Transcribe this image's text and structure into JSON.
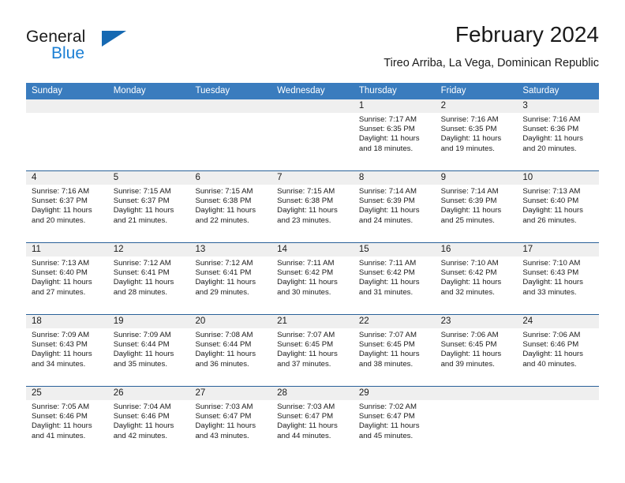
{
  "brand": {
    "name_part1": "General",
    "name_part2": "Blue",
    "logo_icon": "triangle-logo-icon",
    "accent_color": "#1b7fd4"
  },
  "header": {
    "title": "February 2024",
    "subtitle": "Tireo Arriba, La Vega, Dominican Republic"
  },
  "theme": {
    "header_blue": "#3a7cbe",
    "separator_blue": "#2a6199",
    "date_band_gray": "#efefef"
  },
  "calendar": {
    "weekdays": [
      "Sunday",
      "Monday",
      "Tuesday",
      "Wednesday",
      "Thursday",
      "Friday",
      "Saturday"
    ],
    "weeks": [
      [
        {
          "day": "",
          "sunrise": "",
          "sunset": "",
          "daylight1": "",
          "daylight2": ""
        },
        {
          "day": "",
          "sunrise": "",
          "sunset": "",
          "daylight1": "",
          "daylight2": ""
        },
        {
          "day": "",
          "sunrise": "",
          "sunset": "",
          "daylight1": "",
          "daylight2": ""
        },
        {
          "day": "",
          "sunrise": "",
          "sunset": "",
          "daylight1": "",
          "daylight2": ""
        },
        {
          "day": "1",
          "sunrise": "Sunrise: 7:17 AM",
          "sunset": "Sunset: 6:35 PM",
          "daylight1": "Daylight: 11 hours",
          "daylight2": "and 18 minutes."
        },
        {
          "day": "2",
          "sunrise": "Sunrise: 7:16 AM",
          "sunset": "Sunset: 6:35 PM",
          "daylight1": "Daylight: 11 hours",
          "daylight2": "and 19 minutes."
        },
        {
          "day": "3",
          "sunrise": "Sunrise: 7:16 AM",
          "sunset": "Sunset: 6:36 PM",
          "daylight1": "Daylight: 11 hours",
          "daylight2": "and 20 minutes."
        }
      ],
      [
        {
          "day": "4",
          "sunrise": "Sunrise: 7:16 AM",
          "sunset": "Sunset: 6:37 PM",
          "daylight1": "Daylight: 11 hours",
          "daylight2": "and 20 minutes."
        },
        {
          "day": "5",
          "sunrise": "Sunrise: 7:15 AM",
          "sunset": "Sunset: 6:37 PM",
          "daylight1": "Daylight: 11 hours",
          "daylight2": "and 21 minutes."
        },
        {
          "day": "6",
          "sunrise": "Sunrise: 7:15 AM",
          "sunset": "Sunset: 6:38 PM",
          "daylight1": "Daylight: 11 hours",
          "daylight2": "and 22 minutes."
        },
        {
          "day": "7",
          "sunrise": "Sunrise: 7:15 AM",
          "sunset": "Sunset: 6:38 PM",
          "daylight1": "Daylight: 11 hours",
          "daylight2": "and 23 minutes."
        },
        {
          "day": "8",
          "sunrise": "Sunrise: 7:14 AM",
          "sunset": "Sunset: 6:39 PM",
          "daylight1": "Daylight: 11 hours",
          "daylight2": "and 24 minutes."
        },
        {
          "day": "9",
          "sunrise": "Sunrise: 7:14 AM",
          "sunset": "Sunset: 6:39 PM",
          "daylight1": "Daylight: 11 hours",
          "daylight2": "and 25 minutes."
        },
        {
          "day": "10",
          "sunrise": "Sunrise: 7:13 AM",
          "sunset": "Sunset: 6:40 PM",
          "daylight1": "Daylight: 11 hours",
          "daylight2": "and 26 minutes."
        }
      ],
      [
        {
          "day": "11",
          "sunrise": "Sunrise: 7:13 AM",
          "sunset": "Sunset: 6:40 PM",
          "daylight1": "Daylight: 11 hours",
          "daylight2": "and 27 minutes."
        },
        {
          "day": "12",
          "sunrise": "Sunrise: 7:12 AM",
          "sunset": "Sunset: 6:41 PM",
          "daylight1": "Daylight: 11 hours",
          "daylight2": "and 28 minutes."
        },
        {
          "day": "13",
          "sunrise": "Sunrise: 7:12 AM",
          "sunset": "Sunset: 6:41 PM",
          "daylight1": "Daylight: 11 hours",
          "daylight2": "and 29 minutes."
        },
        {
          "day": "14",
          "sunrise": "Sunrise: 7:11 AM",
          "sunset": "Sunset: 6:42 PM",
          "daylight1": "Daylight: 11 hours",
          "daylight2": "and 30 minutes."
        },
        {
          "day": "15",
          "sunrise": "Sunrise: 7:11 AM",
          "sunset": "Sunset: 6:42 PM",
          "daylight1": "Daylight: 11 hours",
          "daylight2": "and 31 minutes."
        },
        {
          "day": "16",
          "sunrise": "Sunrise: 7:10 AM",
          "sunset": "Sunset: 6:42 PM",
          "daylight1": "Daylight: 11 hours",
          "daylight2": "and 32 minutes."
        },
        {
          "day": "17",
          "sunrise": "Sunrise: 7:10 AM",
          "sunset": "Sunset: 6:43 PM",
          "daylight1": "Daylight: 11 hours",
          "daylight2": "and 33 minutes."
        }
      ],
      [
        {
          "day": "18",
          "sunrise": "Sunrise: 7:09 AM",
          "sunset": "Sunset: 6:43 PM",
          "daylight1": "Daylight: 11 hours",
          "daylight2": "and 34 minutes."
        },
        {
          "day": "19",
          "sunrise": "Sunrise: 7:09 AM",
          "sunset": "Sunset: 6:44 PM",
          "daylight1": "Daylight: 11 hours",
          "daylight2": "and 35 minutes."
        },
        {
          "day": "20",
          "sunrise": "Sunrise: 7:08 AM",
          "sunset": "Sunset: 6:44 PM",
          "daylight1": "Daylight: 11 hours",
          "daylight2": "and 36 minutes."
        },
        {
          "day": "21",
          "sunrise": "Sunrise: 7:07 AM",
          "sunset": "Sunset: 6:45 PM",
          "daylight1": "Daylight: 11 hours",
          "daylight2": "and 37 minutes."
        },
        {
          "day": "22",
          "sunrise": "Sunrise: 7:07 AM",
          "sunset": "Sunset: 6:45 PM",
          "daylight1": "Daylight: 11 hours",
          "daylight2": "and 38 minutes."
        },
        {
          "day": "23",
          "sunrise": "Sunrise: 7:06 AM",
          "sunset": "Sunset: 6:45 PM",
          "daylight1": "Daylight: 11 hours",
          "daylight2": "and 39 minutes."
        },
        {
          "day": "24",
          "sunrise": "Sunrise: 7:06 AM",
          "sunset": "Sunset: 6:46 PM",
          "daylight1": "Daylight: 11 hours",
          "daylight2": "and 40 minutes."
        }
      ],
      [
        {
          "day": "25",
          "sunrise": "Sunrise: 7:05 AM",
          "sunset": "Sunset: 6:46 PM",
          "daylight1": "Daylight: 11 hours",
          "daylight2": "and 41 minutes."
        },
        {
          "day": "26",
          "sunrise": "Sunrise: 7:04 AM",
          "sunset": "Sunset: 6:46 PM",
          "daylight1": "Daylight: 11 hours",
          "daylight2": "and 42 minutes."
        },
        {
          "day": "27",
          "sunrise": "Sunrise: 7:03 AM",
          "sunset": "Sunset: 6:47 PM",
          "daylight1": "Daylight: 11 hours",
          "daylight2": "and 43 minutes."
        },
        {
          "day": "28",
          "sunrise": "Sunrise: 7:03 AM",
          "sunset": "Sunset: 6:47 PM",
          "daylight1": "Daylight: 11 hours",
          "daylight2": "and 44 minutes."
        },
        {
          "day": "29",
          "sunrise": "Sunrise: 7:02 AM",
          "sunset": "Sunset: 6:47 PM",
          "daylight1": "Daylight: 11 hours",
          "daylight2": "and 45 minutes."
        },
        {
          "day": "",
          "sunrise": "",
          "sunset": "",
          "daylight1": "",
          "daylight2": ""
        },
        {
          "day": "",
          "sunrise": "",
          "sunset": "",
          "daylight1": "",
          "daylight2": ""
        }
      ]
    ]
  }
}
